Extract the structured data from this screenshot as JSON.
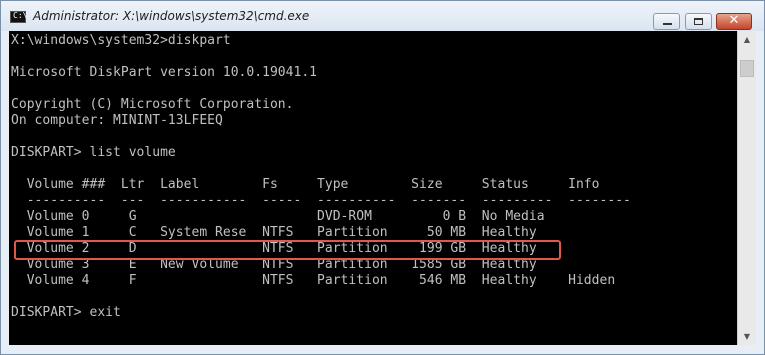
{
  "window": {
    "title": "Administrator: X:\\windows\\system32\\cmd.exe",
    "icon_text": "C:\\",
    "controls": {
      "minimize": "minimize-icon",
      "maximize": "maximize-icon",
      "close": "close-icon",
      "close_glyph": "✕"
    }
  },
  "console": {
    "lines": [
      "X:\\windows\\system32>diskpart",
      "",
      "Microsoft DiskPart version 10.0.19041.1",
      "",
      "Copyright (C) Microsoft Corporation.",
      "On computer: MININT-13LFEEQ",
      "",
      "DISKPART> list volume",
      "",
      "  Volume ###  Ltr  Label        Fs     Type        Size     Status     Info",
      "  ----------  ---  -----------  -----  ----------  -------  ---------  --------",
      "  Volume 0     G                       DVD-ROM         0 B  No Media",
      "  Volume 1     C   System Rese  NTFS   Partition     50 MB  Healthy",
      "  Volume 2     D                NTFS   Partition    199 GB  Healthy",
      "  Volume 3     E   New Volume   NTFS   Partition   1585 GB  Healthy",
      "  Volume 4     F                NTFS   Partition    546 MB  Healthy    Hidden",
      "",
      "DISKPART> exit"
    ],
    "highlighted_row": "Volume 2",
    "colors": {
      "background": "#000000",
      "text": "#c0c0c0",
      "highlight": "#e2574c"
    }
  },
  "scrollbar": {
    "up_glyph": "▲",
    "down_glyph": "▼"
  }
}
